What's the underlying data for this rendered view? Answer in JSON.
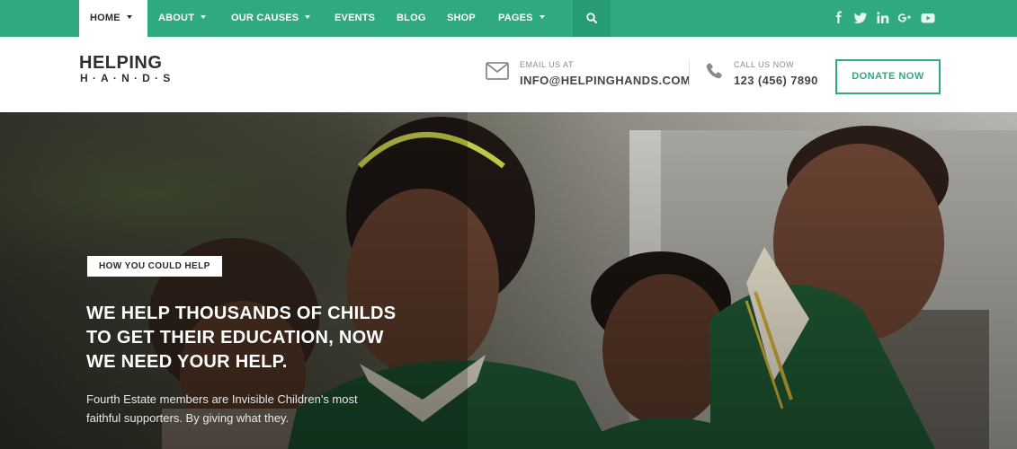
{
  "nav": {
    "items": [
      {
        "label": "Home",
        "has_caret": true,
        "active": true
      },
      {
        "label": "About",
        "has_caret": true
      },
      {
        "label": "Our Causes",
        "has_caret": true
      },
      {
        "label": "Events",
        "has_caret": false
      },
      {
        "label": "Blog",
        "has_caret": false
      },
      {
        "label": "Shop",
        "has_caret": false
      },
      {
        "label": "Pages",
        "has_caret": true
      }
    ],
    "search_icon": "search-icon",
    "social_icons": [
      "facebook-icon",
      "twitter-icon",
      "linkedin-icon",
      "google-plus-icon",
      "youtube-icon"
    ]
  },
  "header": {
    "logo_top": "HELPING",
    "logo_bottom": "H·A·N·D·S",
    "email_label": "EMAIL US AT",
    "email_value": "INFO@HELPINGHANDS.COM",
    "phone_label": "CALL US NOW",
    "phone_value": "123 (456) 7890",
    "donate_label": "DONATE NOW"
  },
  "hero": {
    "tag": "HOW YOU COULD HELP",
    "title_line1": "WE HELP THOUSANDS OF CHILDS",
    "title_line2": "TO GET THEIR EDUCATION, NOW",
    "title_line3": "WE NEED YOUR HELP.",
    "desc_line1": "Fourth Estate members are Invisible Children's most",
    "desc_line2": "faithful supporters. By giving what they."
  },
  "colors": {
    "brand": "#2eaa7e",
    "search_bg": "#279c72"
  }
}
